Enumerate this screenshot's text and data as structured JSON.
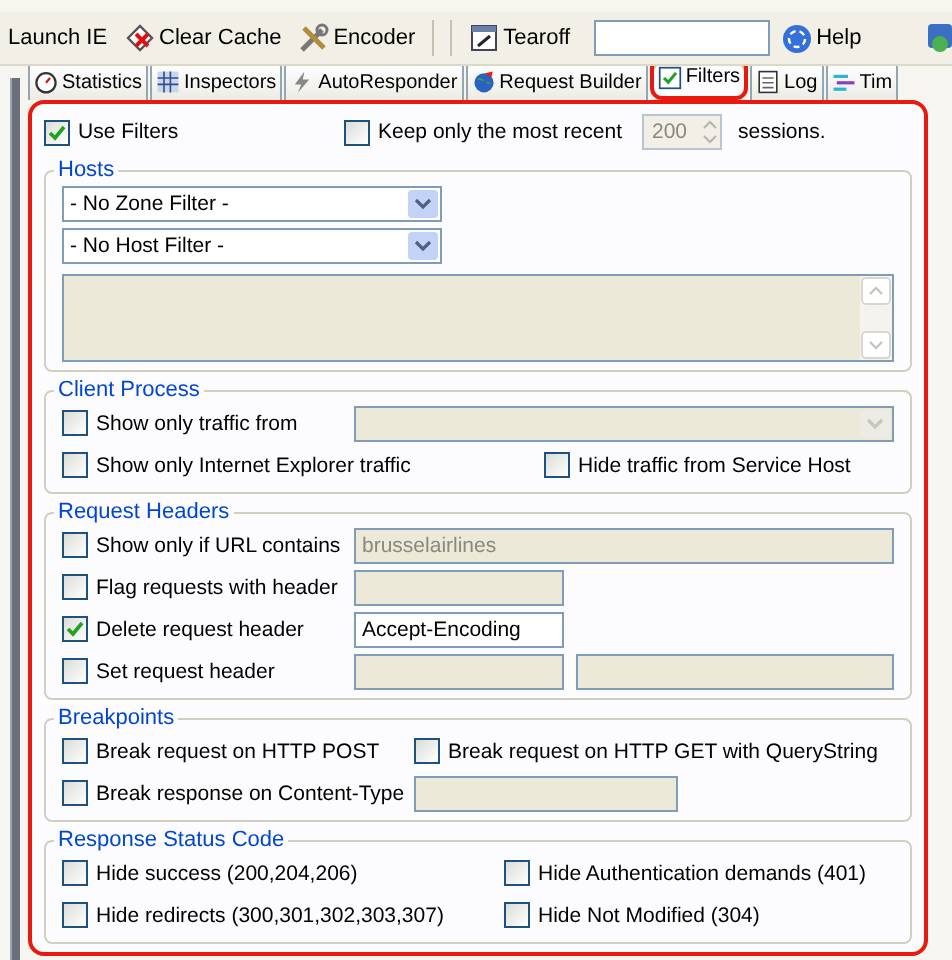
{
  "toolbar": [
    {
      "label": "Launch IE"
    },
    {
      "label": "Clear Cache"
    },
    {
      "label": "Encoder"
    },
    {
      "label": "Tearoff"
    },
    {
      "label": "Help"
    }
  ],
  "tabs": [
    {
      "label": "Statistics",
      "selected": false
    },
    {
      "label": "Inspectors",
      "selected": false
    },
    {
      "label": "AutoResponder",
      "selected": false
    },
    {
      "label": "Request Builder",
      "selected": false
    },
    {
      "label": "Filters",
      "selected": true
    },
    {
      "label": "Log",
      "selected": false
    },
    {
      "label": "Tim",
      "selected": false
    }
  ],
  "use_filters": {
    "label": "Use Filters",
    "checked": true
  },
  "keep_recent": {
    "label": "Keep only the most recent",
    "checked": false,
    "value": "200",
    "disabled": true,
    "suffix": "sessions."
  },
  "sections": [
    {
      "title": "Hosts",
      "rows": [
        [
          {
            "kind": "select",
            "value": "- No Zone Filter -",
            "disabled": false
          }
        ],
        [
          {
            "kind": "select",
            "value": "- No Host Filter -",
            "disabled": false
          }
        ],
        [
          {
            "kind": "textarea",
            "disabled": true
          }
        ]
      ]
    },
    {
      "title": "Client Process",
      "rows": [
        [
          {
            "kind": "checkbox",
            "label": "Show only traffic from",
            "checked": false
          },
          {
            "kind": "select",
            "disabled": true
          }
        ],
        [
          {
            "kind": "checkbox",
            "label": "Show only Internet Explorer traffic",
            "checked": false
          },
          {
            "kind": "checkbox",
            "label": "Hide traffic from Service Host",
            "checked": false
          }
        ]
      ]
    },
    {
      "title": "Request Headers",
      "rows": [
        [
          {
            "kind": "checkbox",
            "label": "Show only if URL contains",
            "checked": false
          },
          {
            "kind": "input",
            "value": "brusselairlines",
            "disabled": true
          }
        ],
        [
          {
            "kind": "checkbox",
            "label": "Flag requests with header",
            "checked": false
          },
          {
            "kind": "input",
            "disabled": true
          }
        ],
        [
          {
            "kind": "checkbox",
            "label": "Delete request header",
            "checked": true
          },
          {
            "kind": "input",
            "value": "Accept-Encoding",
            "disabled": false
          }
        ],
        [
          {
            "kind": "checkbox",
            "label": "Set request header",
            "checked": false
          },
          {
            "kind": "input",
            "disabled": true
          },
          {
            "kind": "input",
            "disabled": true
          }
        ]
      ]
    },
    {
      "title": "Breakpoints",
      "rows": [
        [
          {
            "kind": "checkbox",
            "label": "Break request on HTTP POST",
            "checked": false
          },
          {
            "kind": "checkbox",
            "label": "Break request on HTTP GET with QueryString",
            "checked": false
          }
        ],
        [
          {
            "kind": "checkbox",
            "label": "Break response on Content-Type",
            "checked": false
          },
          {
            "kind": "input",
            "disabled": true
          }
        ]
      ]
    },
    {
      "title": "Response Status Code",
      "rows": [
        [
          {
            "kind": "checkbox",
            "label": "Hide success (200,204,206)",
            "checked": false
          },
          {
            "kind": "checkbox",
            "label": "Hide Authentication demands (401)",
            "checked": false
          }
        ],
        [
          {
            "kind": "checkbox",
            "label": "Hide redirects (300,301,302,303,307)",
            "checked": false
          },
          {
            "kind": "checkbox",
            "label": "Hide Not Modified (304)",
            "checked": false
          }
        ]
      ]
    }
  ]
}
